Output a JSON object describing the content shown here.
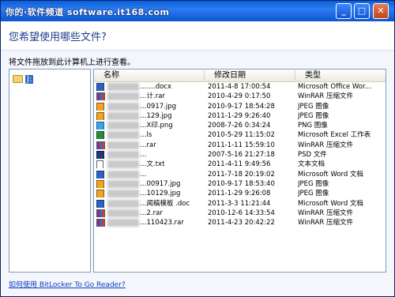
{
  "watermark": "你的·软件频道 software.it168.com",
  "window_controls": {
    "minimize": "_",
    "maximize": "□",
    "close": "✕"
  },
  "question": "您希望使用哪些文件?",
  "instruction": "将文件拖放到此计算机上进行查看。",
  "tree": {
    "item_label": "J:"
  },
  "columns": {
    "name": "名称",
    "date": "修改日期",
    "type": "类型"
  },
  "files": [
    {
      "icon": "doc-icon",
      "name": "…….docx",
      "date": "2011-4-8 17:00:54",
      "type": "Microsoft Office Wor..."
    },
    {
      "icon": "rar-icon",
      "name": "…计.rar",
      "date": "2010-4-29 0:17:50",
      "type": "WinRAR 压缩文件"
    },
    {
      "icon": "jpg-icon",
      "name": "…0917.jpg",
      "date": "2010-9-17 18:54:28",
      "type": "JPEG 图像"
    },
    {
      "icon": "jpg-icon",
      "name": "…129.jpg",
      "date": "2011-1-29 9:26:40",
      "type": "JPEG 图像"
    },
    {
      "icon": "png-icon",
      "name": "…X印.png",
      "date": "2008-7-26 0:34:24",
      "type": "PNG 图像"
    },
    {
      "icon": "xls-icon",
      "name": "…ls",
      "date": "2010-5-29 11:15:02",
      "type": "Microsoft Excel 工作表"
    },
    {
      "icon": "rar-icon",
      "name": "…rar",
      "date": "2011-1-11 15:59:10",
      "type": "WinRAR 压缩文件"
    },
    {
      "icon": "psd-icon",
      "name": "…",
      "date": "2007-5-16 21:27:18",
      "type": "PSD 文件"
    },
    {
      "icon": "txt-icon",
      "name": "…文.txt",
      "date": "2011-4-11 9:49:56",
      "type": "文本文档"
    },
    {
      "icon": "doc-icon",
      "name": "…",
      "date": "2011-7-18 20:19:02",
      "type": "Microsoft Word 文档"
    },
    {
      "icon": "jpg-icon",
      "name": "…00917.jpg",
      "date": "2010-9-17 18:53:40",
      "type": "JPEG 图像"
    },
    {
      "icon": "jpg-icon",
      "name": "…10129.jpg",
      "date": "2011-1-29 9:26:08",
      "type": "JPEG 图像"
    },
    {
      "icon": "doc-icon",
      "name": "…闻稿模板 .doc",
      "date": "2011-3-3 11:21:44",
      "type": "Microsoft Word 文档"
    },
    {
      "icon": "rar-icon",
      "name": "…2.rar",
      "date": "2010-12-6 14:33:54",
      "type": "WinRAR 压缩文件"
    },
    {
      "icon": "rar-icon",
      "name": "…110423.rar",
      "date": "2011-4-23 20:42:22",
      "type": "WinRAR 压缩文件"
    }
  ],
  "footer_link": "如何使用 BitLocker To Go Reader?"
}
